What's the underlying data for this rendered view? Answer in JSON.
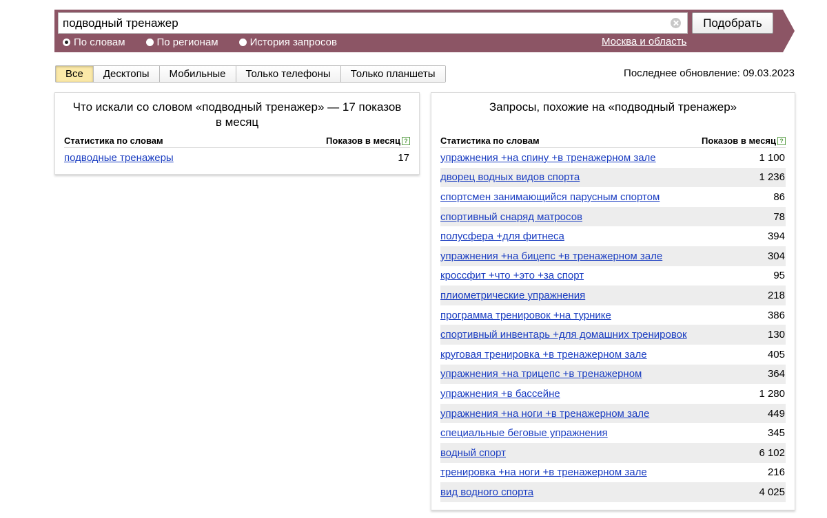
{
  "search": {
    "query": "подводный тренажер",
    "submit_label": "Подобрать",
    "modes": [
      {
        "label": "По словам",
        "selected": true
      },
      {
        "label": "По регионам",
        "selected": false
      },
      {
        "label": "История запросов",
        "selected": false
      }
    ],
    "region": "Москва и область"
  },
  "colors": {
    "banner": "#8c5565",
    "link": "#1a3dc1",
    "active_tab": "#fbe9a8",
    "help_icon": "#5ca04a"
  },
  "tabs": [
    {
      "label": "Все",
      "active": true
    },
    {
      "label": "Десктопы",
      "active": false
    },
    {
      "label": "Мобильные",
      "active": false
    },
    {
      "label": "Только телефоны",
      "active": false
    },
    {
      "label": "Только планшеты",
      "active": false
    }
  ],
  "last_update": "Последнее обновление: 09.03.2023",
  "left_panel": {
    "title": "Что искали со словом «подводный тренажер» — 17 показов в месяц",
    "col_words": "Статистика по словам",
    "col_shows": "Показов в месяц",
    "help_icon": "?",
    "rows": [
      {
        "phrase": "подводные тренажеры",
        "count": "17"
      }
    ]
  },
  "right_panel": {
    "title": "Запросы, похожие на «подводный тренажер»",
    "col_words": "Статистика по словам",
    "col_shows": "Показов в месяц",
    "help_icon": "?",
    "rows": [
      {
        "phrase": "упражнения +на спину +в тренажерном зале",
        "count": "1 100"
      },
      {
        "phrase": "дворец водных видов спорта",
        "count": "1 236"
      },
      {
        "phrase": "спортсмен занимающийся парусным спортом",
        "count": "86"
      },
      {
        "phrase": "спортивный снаряд матросов",
        "count": "78"
      },
      {
        "phrase": "полусфера +для фитнеса",
        "count": "394"
      },
      {
        "phrase": "упражнения +на бицепс +в тренажерном зале",
        "count": "304"
      },
      {
        "phrase": "кроссфит +что +это +за спорт",
        "count": "95"
      },
      {
        "phrase": "плиометрические упражнения",
        "count": "218"
      },
      {
        "phrase": "программа тренировок +на турнике",
        "count": "386"
      },
      {
        "phrase": "спортивный инвентарь +для домашних тренировок",
        "count": "130"
      },
      {
        "phrase": "круговая тренировка +в тренажерном зале",
        "count": "405"
      },
      {
        "phrase": "упражнения +на трицепс +в тренажерном",
        "count": "364"
      },
      {
        "phrase": "упражнения +в бассейне",
        "count": "1 280"
      },
      {
        "phrase": "упражнения +на ноги +в тренажерном зале",
        "count": "449"
      },
      {
        "phrase": "специальные беговые упражнения",
        "count": "345"
      },
      {
        "phrase": "водный спорт",
        "count": "6 102"
      },
      {
        "phrase": "тренировка +на ноги +в тренажерном зале",
        "count": "216"
      },
      {
        "phrase": "вид водного спорта",
        "count": "4 025"
      }
    ]
  }
}
